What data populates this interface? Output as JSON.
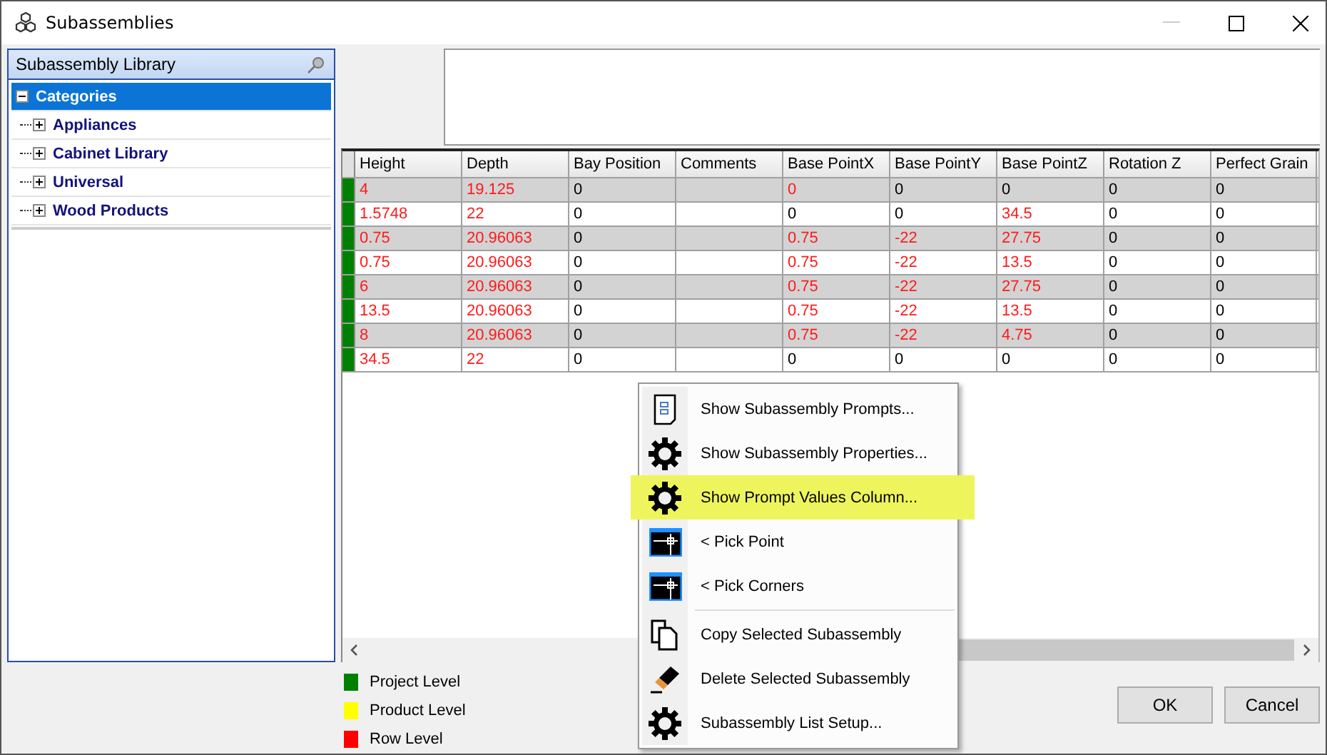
{
  "window": {
    "title": "Subassemblies",
    "minimize_disabled": true
  },
  "library": {
    "title": "Subassembly Library",
    "tree": [
      {
        "label": "Categories",
        "expanded": true,
        "selected": true,
        "children": [
          {
            "label": "Appliances",
            "expanded": false,
            "selected": false
          },
          {
            "label": "Cabinet Library",
            "expanded": false,
            "selected": false
          },
          {
            "label": "Universal",
            "expanded": false,
            "selected": false
          },
          {
            "label": "Wood Products",
            "expanded": false,
            "selected": false
          }
        ]
      }
    ]
  },
  "table": {
    "columns": [
      "Height",
      "Depth",
      "Bay Position",
      "Comments",
      "Base PointX",
      "Base PointY",
      "Base PointZ",
      "Rotation Z",
      "Perfect Grain"
    ],
    "rows": [
      {
        "color": "#008000",
        "cells": [
          {
            "text": "4",
            "modified": true
          },
          {
            "text": "19.125",
            "modified": true
          },
          {
            "text": "0",
            "modified": false
          },
          null,
          {
            "text": "0",
            "modified": true
          },
          {
            "text": "0",
            "modified": false
          },
          {
            "text": "0",
            "modified": false
          },
          {
            "text": "0",
            "modified": false
          },
          {
            "text": "0",
            "modified": false
          }
        ]
      },
      {
        "color": "#008000",
        "cells": [
          {
            "text": "1.5748",
            "modified": true
          },
          {
            "text": "22",
            "modified": true
          },
          {
            "text": "0",
            "modified": false
          },
          null,
          {
            "text": "0",
            "modified": false
          },
          {
            "text": "0",
            "modified": false
          },
          {
            "text": "34.5",
            "modified": true
          },
          {
            "text": "0",
            "modified": false
          },
          {
            "text": "0",
            "modified": false
          }
        ]
      },
      {
        "color": "#008000",
        "cells": [
          {
            "text": "0.75",
            "modified": true
          },
          {
            "text": "20.96063",
            "modified": true
          },
          {
            "text": "0",
            "modified": false
          },
          null,
          {
            "text": "0.75",
            "modified": true
          },
          {
            "text": "-22",
            "modified": true
          },
          {
            "text": "27.75",
            "modified": true
          },
          {
            "text": "0",
            "modified": false
          },
          {
            "text": "0",
            "modified": false
          }
        ]
      },
      {
        "color": "#008000",
        "cells": [
          {
            "text": "0.75",
            "modified": true
          },
          {
            "text": "20.96063",
            "modified": true
          },
          {
            "text": "0",
            "modified": false
          },
          null,
          {
            "text": "0.75",
            "modified": true
          },
          {
            "text": "-22",
            "modified": true
          },
          {
            "text": "13.5",
            "modified": true
          },
          {
            "text": "0",
            "modified": false
          },
          {
            "text": "0",
            "modified": false
          }
        ]
      },
      {
        "color": "#008000",
        "cells": [
          {
            "text": "6",
            "modified": true
          },
          {
            "text": "20.96063",
            "modified": true
          },
          {
            "text": "0",
            "modified": false
          },
          null,
          {
            "text": "0.75",
            "modified": true
          },
          {
            "text": "-22",
            "modified": true
          },
          {
            "text": "27.75",
            "modified": true
          },
          {
            "text": "0",
            "modified": false
          },
          {
            "text": "0",
            "modified": false
          }
        ]
      },
      {
        "color": "#008000",
        "cells": [
          {
            "text": "13.5",
            "modified": true
          },
          {
            "text": "20.96063",
            "modified": true
          },
          {
            "text": "0",
            "modified": false
          },
          null,
          {
            "text": "0.75",
            "modified": true
          },
          {
            "text": "-22",
            "modified": true
          },
          {
            "text": "13.5",
            "modified": true
          },
          {
            "text": "0",
            "modified": false
          },
          {
            "text": "0",
            "modified": false
          }
        ]
      },
      {
        "color": "#008000",
        "cells": [
          {
            "text": "8",
            "modified": true
          },
          {
            "text": "20.96063",
            "modified": true
          },
          {
            "text": "0",
            "modified": false
          },
          null,
          {
            "text": "0.75",
            "modified": true
          },
          {
            "text": "-22",
            "modified": true
          },
          {
            "text": "4.75",
            "modified": true
          },
          {
            "text": "0",
            "modified": false
          },
          {
            "text": "0",
            "modified": false
          }
        ]
      },
      {
        "color": "#008000",
        "cells": [
          {
            "text": "34.5",
            "modified": true
          },
          {
            "text": "22",
            "modified": true
          },
          {
            "text": "0",
            "modified": false
          },
          null,
          {
            "text": "0",
            "modified": false
          },
          {
            "text": "0",
            "modified": false
          },
          {
            "text": "0",
            "modified": false
          },
          {
            "text": "0",
            "modified": false
          },
          {
            "text": "0",
            "modified": false
          }
        ]
      }
    ]
  },
  "context_menu": [
    {
      "kind": "prompts",
      "label": "Show Subassembly Prompts...",
      "selected": false
    },
    {
      "kind": "gear",
      "label": "Show Subassembly Properties...",
      "selected": false
    },
    {
      "kind": "gear",
      "label": "Show Prompt Values Column...",
      "selected": true
    },
    {
      "kind": "pick",
      "label": "< Pick Point",
      "selected": false
    },
    {
      "kind": "pick",
      "label": "< Pick Corners",
      "selected": false
    },
    {
      "kind": "separator"
    },
    {
      "kind": "copy",
      "label": "Copy Selected Subassembly",
      "selected": false
    },
    {
      "kind": "eraser",
      "label": "Delete Selected Subassembly",
      "selected": false
    },
    {
      "kind": "gear",
      "label": "Subassembly List Setup...",
      "selected": false
    }
  ],
  "legend": [
    {
      "label": "Project Level",
      "color": "#008000"
    },
    {
      "label": "Product Level",
      "color": "#ffff00"
    },
    {
      "label": "Row Level",
      "color": "#ff0000"
    }
  ],
  "buttons": [
    "OK",
    "Cancel"
  ]
}
